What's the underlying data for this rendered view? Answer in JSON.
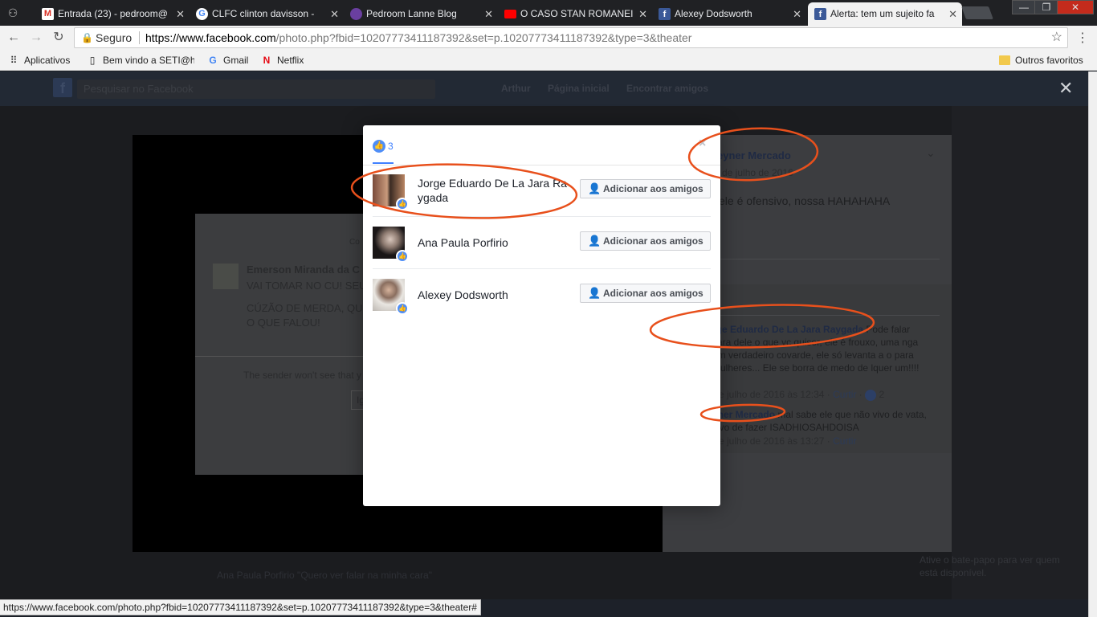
{
  "browser": {
    "tabs": [
      {
        "title": "Entrada (23) - pedroom@",
        "icon": "gmail-icon",
        "color": "#d93025"
      },
      {
        "title": "CLFC clinton davisson - ",
        "icon": "google-icon",
        "color": "#4285f4"
      },
      {
        "title": "Pedroom Lanne Blog",
        "icon": "blog-icon",
        "color": "#6a3fa0"
      },
      {
        "title": "O CASO STAN ROMANEI",
        "icon": "youtube-icon",
        "color": "#ff0000"
      },
      {
        "title": "Alexey Dodsworth",
        "icon": "facebook-icon",
        "color": "#3b5998"
      },
      {
        "title": "Alerta: tem um sujeito fa",
        "icon": "facebook-icon",
        "color": "#3b5998"
      }
    ],
    "security_label": "Seguro",
    "url_host": "https://www.facebook.com",
    "url_path": "/photo.php?fbid=10207773411187392&set=p.10207773411187392&type=3&theater",
    "bookmarks": [
      {
        "label": "Aplicativos",
        "icon": "apps-grid-icon"
      },
      {
        "label": "Bem vindo a SETI@ho",
        "icon": "page-icon"
      },
      {
        "label": "Gmail",
        "icon": "google-icon"
      },
      {
        "label": "Netflix",
        "icon": "netflix-icon"
      },
      {
        "label": "Outros favoritos",
        "icon": "folder-icon"
      }
    ],
    "status_url": "https://www.facebook.com/photo.php?fbid=10207773411187392&set=p.10207773411187392&type=3&theater#"
  },
  "background": {
    "search_placeholder": "Pesquisar no Facebook",
    "nav": [
      "Arthur",
      "Página inicial",
      "Encontrar amigos"
    ],
    "screenshot": {
      "top_label": "Co",
      "sender": "Emerson Miranda da C",
      "line1": "VAI TOMAR NO CU! SEU",
      "line2": "CÚZÃO DE MERDA, QU",
      "line3": "O QUE FALOU!",
      "footer": "The sender won't see that y",
      "button": "Ig"
    },
    "post": {
      "author": "eyner Mercado",
      "date": "de julho de 2016",
      "text": "ele é ofensivo, nossa HAHAHAHA",
      "comment1_author": "rge Eduardo De La Jara Raygada",
      "comment1_text": " Pode falar cara dele o que vc quiser, ele é frouxo, uma nga um verdadeiro covarde, ele só levanta a o para mulheres... Ele se borra de medo de lquer um!!!!",
      "comment1_meta": "e julho de 2016 às 12:34 · ",
      "comment1_likes": "2",
      "comment2_author": "yner Mercado",
      "comment2_text": " mal sabe ele que não vivo de vata, vivo de fazer ISADHIOSAHDOISA",
      "comment2_meta": "e julho de 2016 às 13:27 · ",
      "curtir": "Curtir"
    },
    "below_text": "Ana Paula Porfirio \"Quero ver falar na minha cara\"",
    "chat_text": "Ative o bate-papo para ver quem está disponível."
  },
  "dialog": {
    "like_count": "3",
    "close_glyph": "×",
    "add_friend_label": "Adicionar aos amigos",
    "people": [
      {
        "name": "Jorge Eduardo De La Jara Raygada"
      },
      {
        "name": "Ana Paula Porfirio"
      },
      {
        "name": "Alexey Dodsworth"
      }
    ]
  },
  "colors": {
    "facebook_blue": "#4080ff",
    "annotation_orange": "#e8501c"
  }
}
